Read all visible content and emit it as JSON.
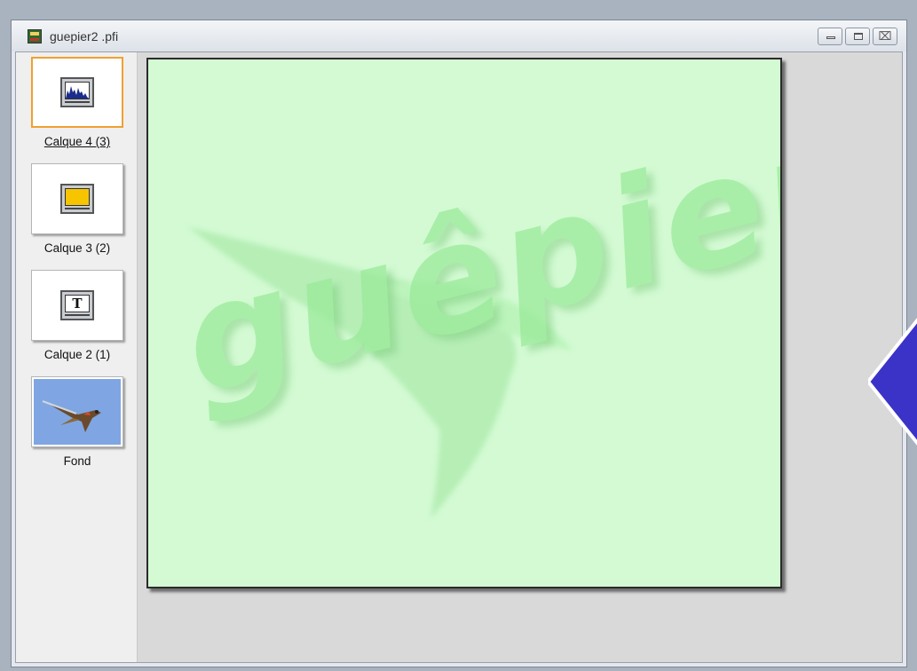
{
  "window": {
    "title": "guepier2 .pfi",
    "controls": [
      "minimize",
      "restore",
      "close"
    ],
    "close_glyph": "⌧"
  },
  "layers": [
    {
      "label": "Calque 4 (3)",
      "icon": "histogram-monitor-icon",
      "selected": true
    },
    {
      "label": "Calque 3 (2)",
      "icon": "fill-monitor-icon",
      "selected": false
    },
    {
      "label": "Calque 2 (1)",
      "icon": "text-monitor-icon",
      "icon_text": "T",
      "selected": false
    },
    {
      "label": "Fond",
      "icon": "bird-photo-thumbnail",
      "selected": false
    }
  ],
  "canvas": {
    "artwork_text": "guêpier",
    "background_color": "#d3fad3",
    "text_color": "#9aea9a"
  },
  "colors": {
    "selection_border": "#f0a030",
    "fill_layer_swatch": "#f7c400",
    "photo_sky": "#7fa6e3",
    "pointer_blue": "#3b32c8"
  }
}
